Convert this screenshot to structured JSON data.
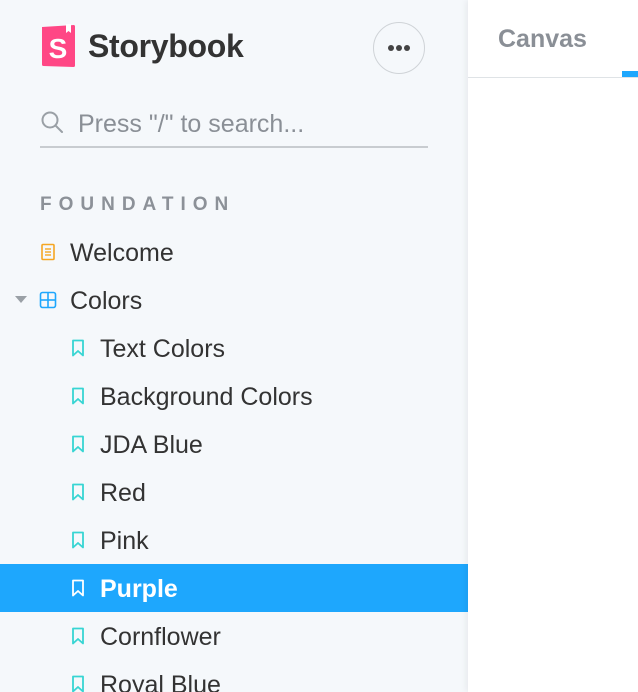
{
  "brand": {
    "name": "Storybook"
  },
  "search": {
    "placeholder": "Press \"/\" to search..."
  },
  "sidebar": {
    "section_title": "FOUNDATION",
    "items": [
      {
        "label": "Welcome",
        "icon": "document-icon",
        "depth": 0
      },
      {
        "label": "Colors",
        "icon": "component-icon",
        "depth": 0,
        "expanded": true
      },
      {
        "label": "Text Colors",
        "icon": "bookmark-icon",
        "depth": 1
      },
      {
        "label": "Background Colors",
        "icon": "bookmark-icon",
        "depth": 1
      },
      {
        "label": "JDA Blue",
        "icon": "bookmark-icon",
        "depth": 1
      },
      {
        "label": "Red",
        "icon": "bookmark-icon",
        "depth": 1
      },
      {
        "label": "Pink",
        "icon": "bookmark-icon",
        "depth": 1
      },
      {
        "label": "Purple",
        "icon": "bookmark-icon",
        "depth": 1,
        "selected": true
      },
      {
        "label": "Cornflower",
        "icon": "bookmark-icon",
        "depth": 1
      },
      {
        "label": "Royal Blue",
        "icon": "bookmark-icon",
        "depth": 1
      }
    ]
  },
  "main": {
    "tabs": [
      {
        "label": "Canvas",
        "active": false
      }
    ]
  },
  "colors": {
    "brand_pink": "#ff4785",
    "selection_blue": "#1ea7fd",
    "document_icon": "#f5a623",
    "component_icon": "#1ea7fd",
    "story_icon": "#37d5d3",
    "sidebar_bg": "#f5f8fb"
  }
}
